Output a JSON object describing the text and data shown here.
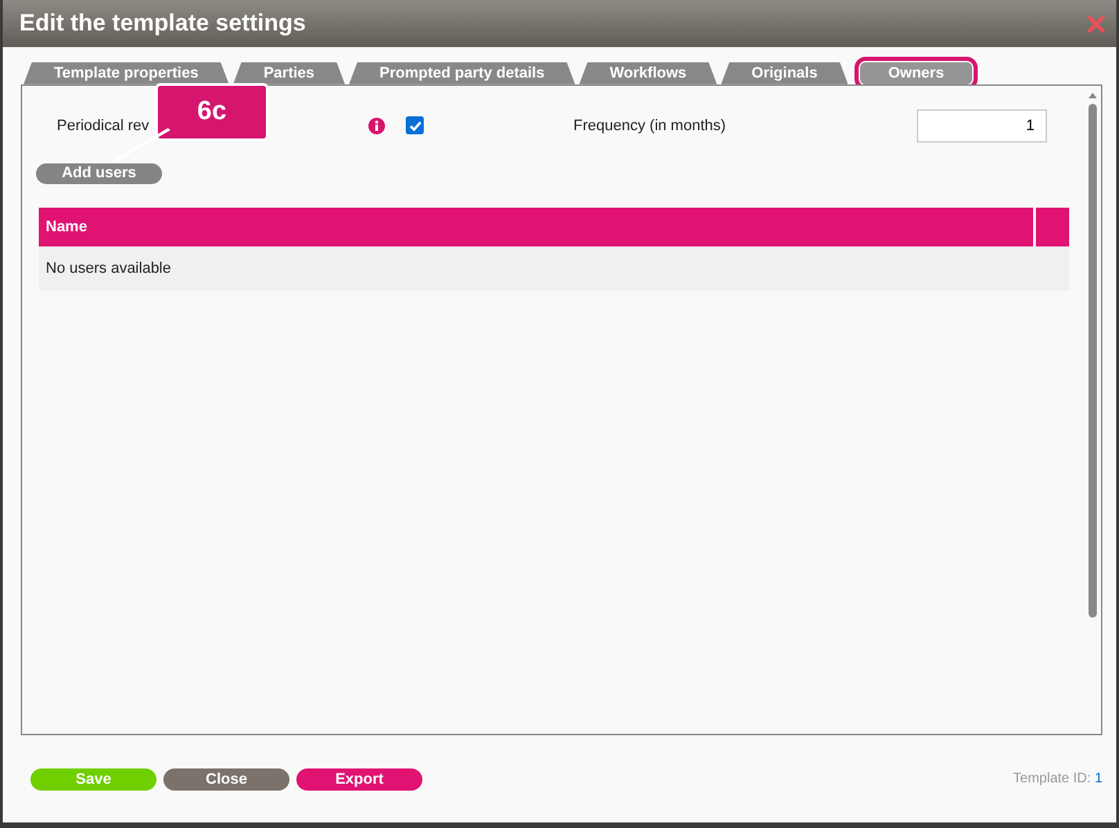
{
  "window": {
    "title": "Edit the template settings"
  },
  "tabs": [
    {
      "label": "Template properties",
      "selected": false
    },
    {
      "label": "Parties",
      "selected": false
    },
    {
      "label": "Prompted party details",
      "selected": false
    },
    {
      "label": "Workflows",
      "selected": false
    },
    {
      "label": "Originals",
      "selected": false
    },
    {
      "label": "Owners",
      "selected": true,
      "highlighted": true
    }
  ],
  "settings": {
    "label": "Periodical rev",
    "checked": true,
    "frequency_label": "Frequency (in months)",
    "frequency_value": "1"
  },
  "callout": {
    "text": "6c"
  },
  "add_button": "Add users",
  "table": {
    "columns": [
      "Name"
    ],
    "empty_text": "No users available"
  },
  "footer": {
    "buttons": [
      {
        "label": "Save",
        "kind": "save"
      },
      {
        "label": "Close",
        "kind": "close"
      },
      {
        "label": "Export",
        "kind": "export"
      }
    ],
    "id_label": "Template ID:",
    "id_value": "1"
  }
}
